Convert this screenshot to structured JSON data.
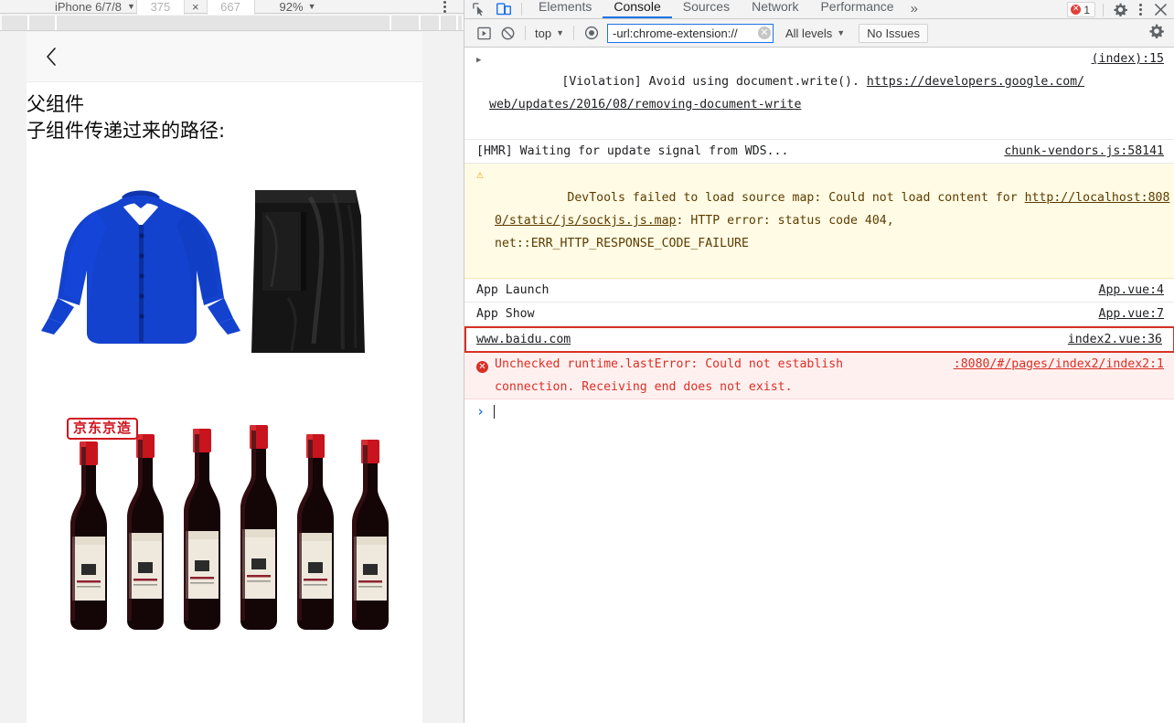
{
  "device_toolbar": {
    "device_name": "iPhone 6/7/8",
    "width": "375",
    "height": "667",
    "times_symbol": "×",
    "zoom": "92%",
    "caret": "▼",
    "menu_icon": "kebab-menu-icon"
  },
  "emulated_page": {
    "back_icon": "back-chevron-icon",
    "title_line1": "父组件",
    "title_line2": "子组件传递过来的路径:",
    "images": [
      {
        "name": "clothing-product-image",
        "alt": "blue blouse and black leather skirt"
      },
      {
        "name": "wine-product-image",
        "alt": "six bottles of red wine",
        "badge": "京东京造"
      }
    ]
  },
  "devtools": {
    "left_icons": [
      {
        "name": "inspect-element-icon",
        "label": "Inspect"
      },
      {
        "name": "device-toolbar-icon",
        "label": "Toggle device toolbar",
        "active": true
      }
    ],
    "tabs": [
      {
        "label": "Elements",
        "active": false
      },
      {
        "label": "Console",
        "active": true
      },
      {
        "label": "Sources",
        "active": false
      },
      {
        "label": "Network",
        "active": false
      },
      {
        "label": "Performance",
        "active": false
      }
    ],
    "more_tabs": "»",
    "error_badge": {
      "icon": "error-circle-icon",
      "count": "1"
    },
    "settings_icon": "gear-icon",
    "main_menu_icon": "kebab-menu-icon",
    "close_icon": "close-icon",
    "accent_color": "#1a73e8",
    "error_color": "#d93025",
    "warn_color": "#e8a500"
  },
  "console_toolbar": {
    "clear_icon": "clear-console-icon",
    "no_entry_icon": "no-entry-icon",
    "context_label": "top",
    "context_caret": "▼",
    "eye_icon": "live-expression-eye-icon",
    "filter_value": "-url:chrome-extension://",
    "filter_placeholder": "Filter",
    "filter_clear_icon": "clear-filter-icon",
    "levels_label": "All levels",
    "levels_caret": "▼",
    "issues_label": "No Issues",
    "settings_icon": "gear-icon"
  },
  "console_rows": [
    {
      "kind": "info",
      "expandable": true,
      "message": "[Violation] Avoid using document.write(). ",
      "link": "https://developers.google.com/web/updates/2016/08/removing-document-write",
      "source": "(index):15"
    },
    {
      "kind": "info",
      "expandable": false,
      "message": "[HMR] Waiting for update signal from WDS...",
      "link": "",
      "source": "chunk-vendors.js:58141"
    },
    {
      "kind": "warn",
      "expandable": false,
      "icon": "warning-triangle-icon",
      "message_pre": "DevTools failed to load source map: Could not load content for ",
      "link": "http://localhost:8080/static/js/sockjs.js.map",
      "message_post": ": HTTP error: status code 404,\nnet::ERR_HTTP_RESPONSE_CODE_FAILURE",
      "source": ""
    },
    {
      "kind": "info",
      "expandable": false,
      "message": "App Launch",
      "link": "",
      "source": "App.vue:4"
    },
    {
      "kind": "info",
      "expandable": false,
      "message": "App Show",
      "link": "",
      "source": "App.vue:7"
    },
    {
      "kind": "info",
      "highlighted": true,
      "expandable": false,
      "message": "www.baidu.com",
      "link": "",
      "source": "index2.vue:36"
    },
    {
      "kind": "err",
      "expandable": false,
      "icon": "error-circle-icon",
      "message": "Unchecked runtime.lastError: Could not establish\nconnection. Receiving end does not exist.",
      "link": "",
      "source": ":8080/#/pages/index2/index2:1"
    }
  ],
  "prompt": {
    "chevron": "›",
    "value": ""
  }
}
